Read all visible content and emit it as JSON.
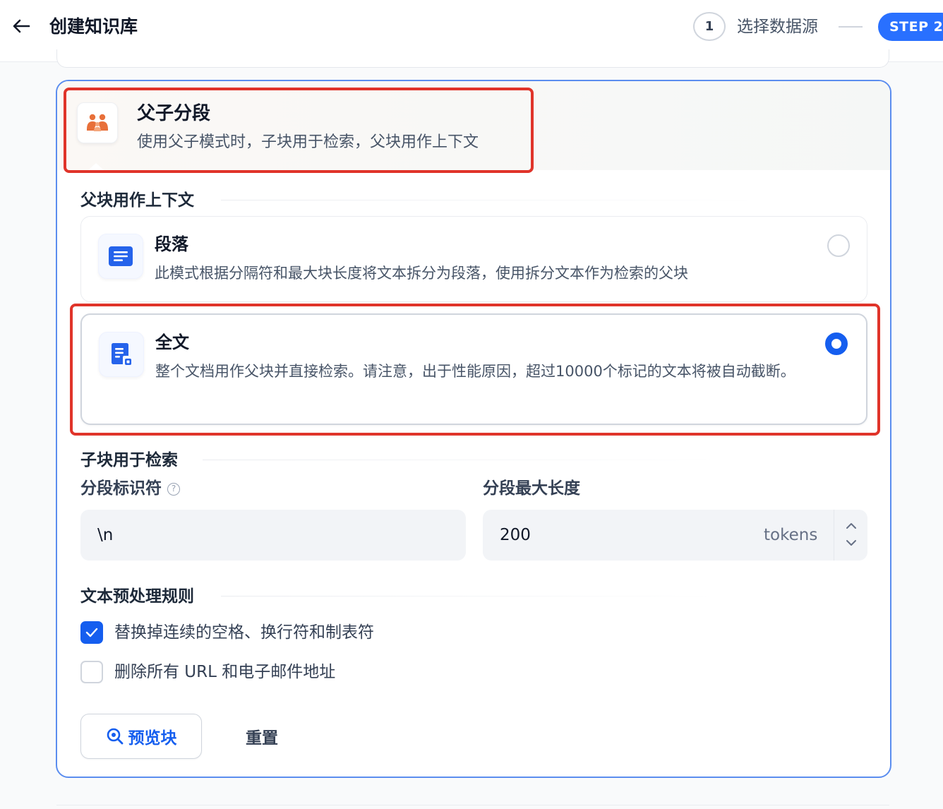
{
  "header": {
    "title": "创建知识库",
    "step1_number": "1",
    "step1_label": "选择数据源",
    "step2_label": "STEP 2"
  },
  "parent_child": {
    "title": "父子分段",
    "description": "使用父子模式时，子块用于检索，父块用作上下文"
  },
  "parent_section": {
    "label": "父块用作上下文",
    "options": [
      {
        "title": "段落",
        "description": "此模式根据分隔符和最大块长度将文本拆分为段落，使用拆分文本作为检索的父块",
        "selected": false
      },
      {
        "title": "全文",
        "description": "整个文档用作父块并直接检索。请注意，出于性能原因，超过10000个标记的文本将被自动截断。",
        "selected": true
      }
    ]
  },
  "child_section": {
    "label": "子块用于检索",
    "separator_label": "分段标识符",
    "separator_help": "?",
    "separator_value": "\\n",
    "max_length_label": "分段最大长度",
    "max_length_value": "200",
    "max_length_unit": "tokens"
  },
  "preprocess": {
    "label": "文本预处理规则",
    "rules": [
      {
        "label": "替换掉连续的空格、换行符和制表符",
        "checked": true
      },
      {
        "label": "删除所有 URL 和电子邮件地址",
        "checked": false
      }
    ]
  },
  "actions": {
    "preview_label": "预览块",
    "reset_label": "重置"
  },
  "colors": {
    "accent": "#155eef",
    "card_border": "#5b8def",
    "highlight": "#e0342a",
    "icon_orange": "#e8703a"
  }
}
